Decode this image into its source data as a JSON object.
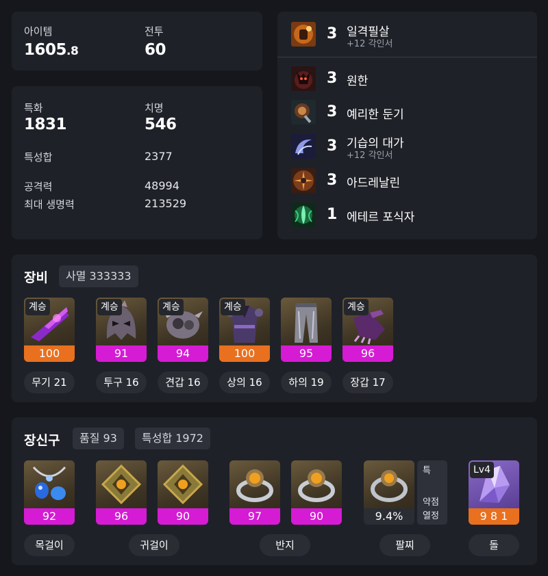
{
  "summary": {
    "item_level_label": "아이템",
    "item_level_int": "1605",
    "item_level_dec": ".8",
    "combat_label": "전투",
    "combat_value": "60"
  },
  "stats": {
    "spec_label": "특화",
    "spec_value": "1831",
    "crit_label": "치명",
    "crit_value": "546",
    "total_label": "특성합",
    "total_value": "2377",
    "attack_label": "공격력",
    "attack_value": "48994",
    "hp_label": "최대 생명력",
    "hp_value": "213529"
  },
  "engravings": [
    {
      "level": "3",
      "name": "일격필살",
      "sub": "+12 각인서",
      "icon": "fist-icon"
    },
    {
      "level": "3",
      "name": "원한",
      "sub": "",
      "icon": "demon-icon"
    },
    {
      "level": "3",
      "name": "예리한 둔기",
      "sub": "",
      "icon": "mace-icon"
    },
    {
      "level": "3",
      "name": "기습의 대가",
      "sub": "+12 각인서",
      "icon": "swirl-icon"
    },
    {
      "level": "3",
      "name": "아드레날린",
      "sub": "",
      "icon": "burst-icon"
    },
    {
      "level": "1",
      "name": "에테르 포식자",
      "sub": "",
      "icon": "ether-icon"
    }
  ],
  "equipment": {
    "title": "장비",
    "set_label": "사멸 333333",
    "items": [
      {
        "badge": "계승",
        "quality": "100",
        "name": "무기 21",
        "icon": "weapon-icon"
      },
      {
        "badge": "계승",
        "quality": "91",
        "name": "투구 16",
        "icon": "helmet-icon"
      },
      {
        "badge": "계승",
        "quality": "94",
        "name": "견갑 16",
        "icon": "shoulder-icon"
      },
      {
        "badge": "계승",
        "quality": "100",
        "name": "상의 16",
        "icon": "chest-icon"
      },
      {
        "badge": "",
        "quality": "95",
        "name": "하의 19",
        "icon": "pants-icon"
      },
      {
        "badge": "계승",
        "quality": "96",
        "name": "장갑 17",
        "icon": "glove-icon"
      }
    ]
  },
  "accessories": {
    "title": "장신구",
    "quality_label": "품질 93",
    "stat_total_label": "특성합 1972",
    "items": [
      {
        "quality": "92",
        "icon": "necklace-icon"
      },
      {
        "quality": "96",
        "icon": "earring-icon"
      },
      {
        "quality": "90",
        "icon": "earring-icon"
      },
      {
        "quality": "97",
        "icon": "ring-icon"
      },
      {
        "quality": "90",
        "icon": "ring-icon"
      },
      {
        "quality": "9.4%",
        "icon": "bracelet-icon"
      },
      {
        "quality": "9 8 1",
        "icon": "stone-icon",
        "badge": "Lv4"
      }
    ],
    "bracelet_effects": [
      "특",
      "약점",
      "열정"
    ],
    "labels": [
      "목걸이",
      "귀걸이",
      "반지",
      "팔찌",
      "돌"
    ]
  },
  "colors": {
    "orange": "#e8701f",
    "magenta": "#d51bd4",
    "card": "#1f2128",
    "background": "#15171c"
  }
}
